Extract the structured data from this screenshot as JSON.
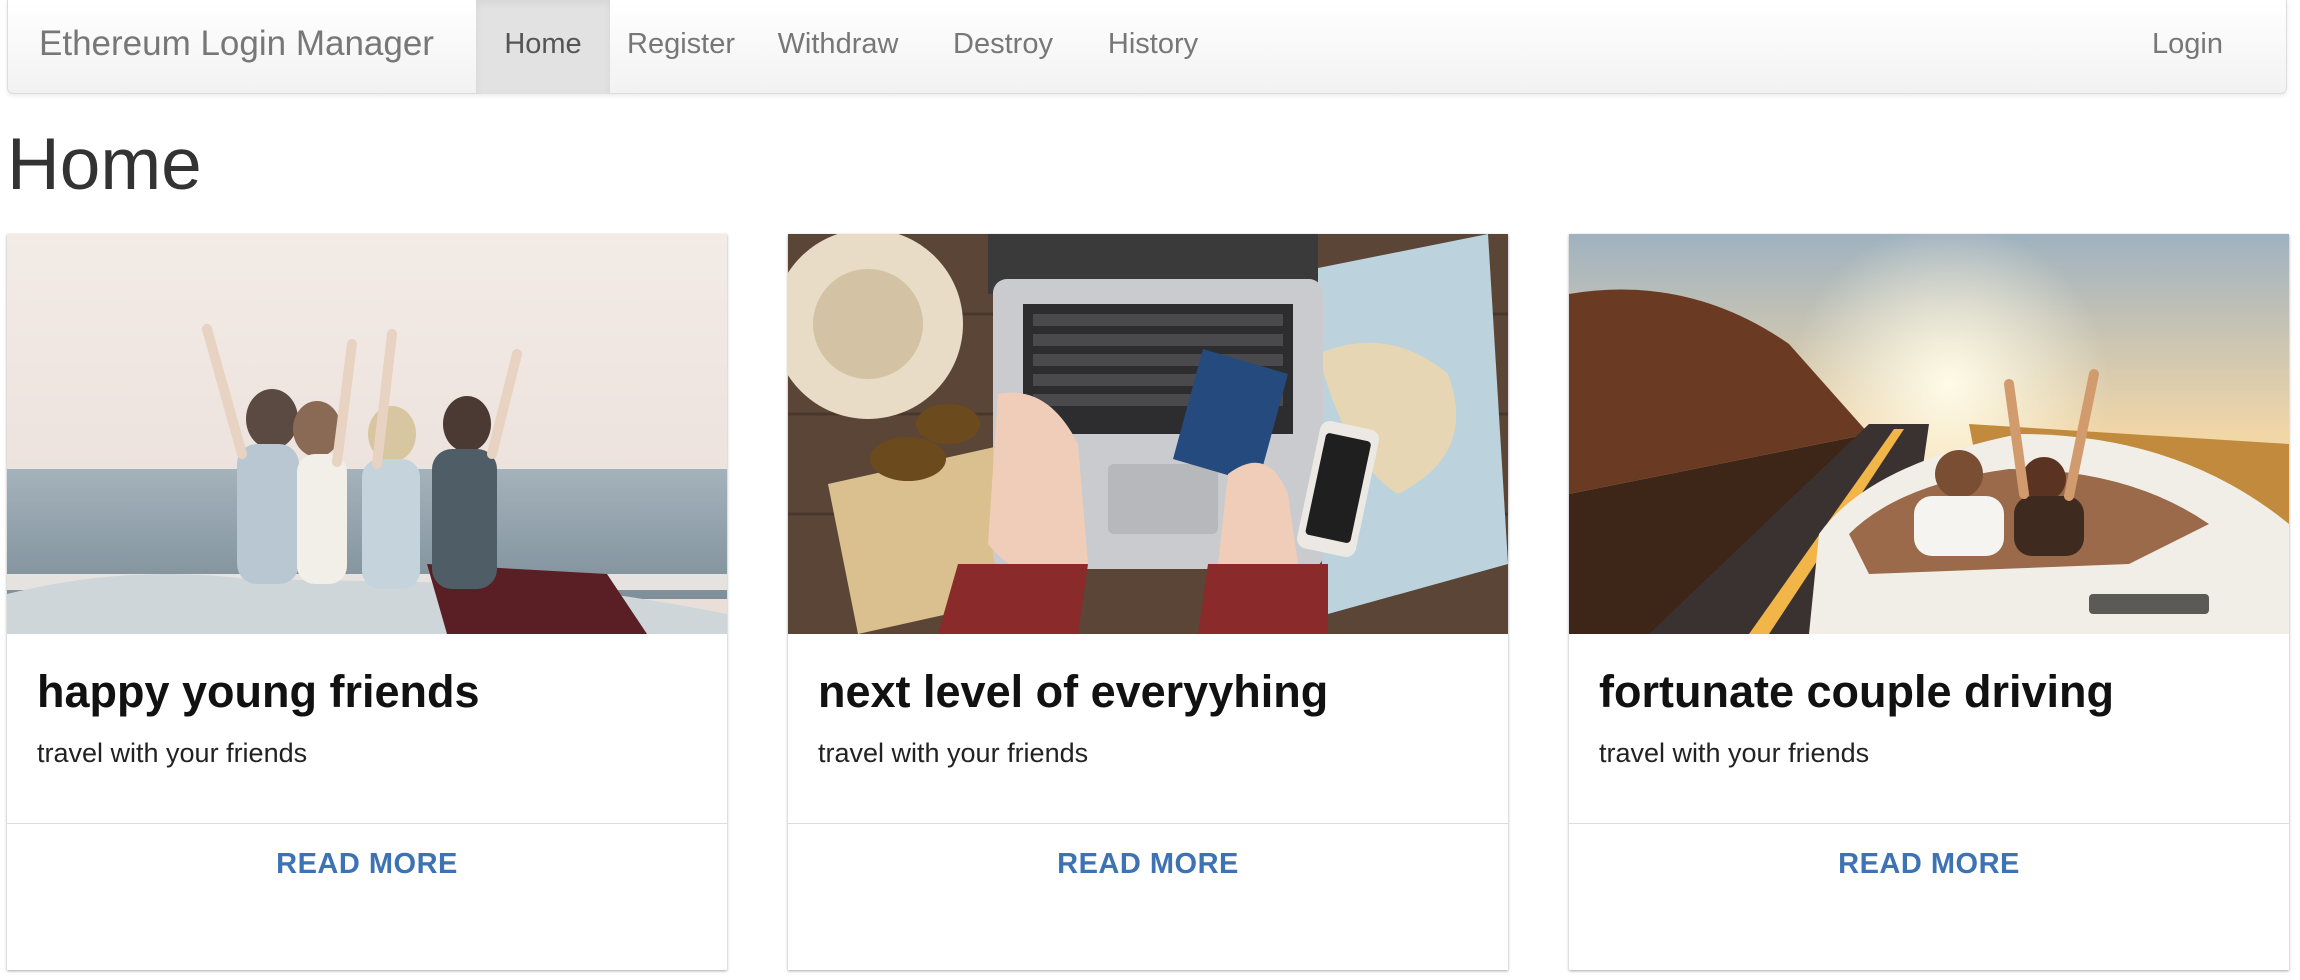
{
  "navbar": {
    "brand": "Ethereum Login Manager",
    "items": [
      {
        "label": "Home",
        "active": true
      },
      {
        "label": "Register",
        "active": false
      },
      {
        "label": "Withdraw",
        "active": false
      },
      {
        "label": "Destroy",
        "active": false
      },
      {
        "label": "History",
        "active": false
      }
    ],
    "login": "Login"
  },
  "page": {
    "title": "Home"
  },
  "cards": [
    {
      "title": "happy young friends",
      "text": "travel with your friends",
      "action": "READ MORE",
      "image": "friends-in-convertible-by-sea"
    },
    {
      "title": "next level of everyyhing",
      "text": "travel with your friends",
      "action": "READ MORE",
      "image": "laptop-passport-map-desk"
    },
    {
      "title": "fortunate couple driving",
      "text": "travel with your friends",
      "action": "READ MORE",
      "image": "couple-driving-sunset-road"
    }
  ],
  "colors": {
    "link": "#3d72b4",
    "nav_active_bg": "#e2e2e2",
    "nav_text": "#777777"
  }
}
